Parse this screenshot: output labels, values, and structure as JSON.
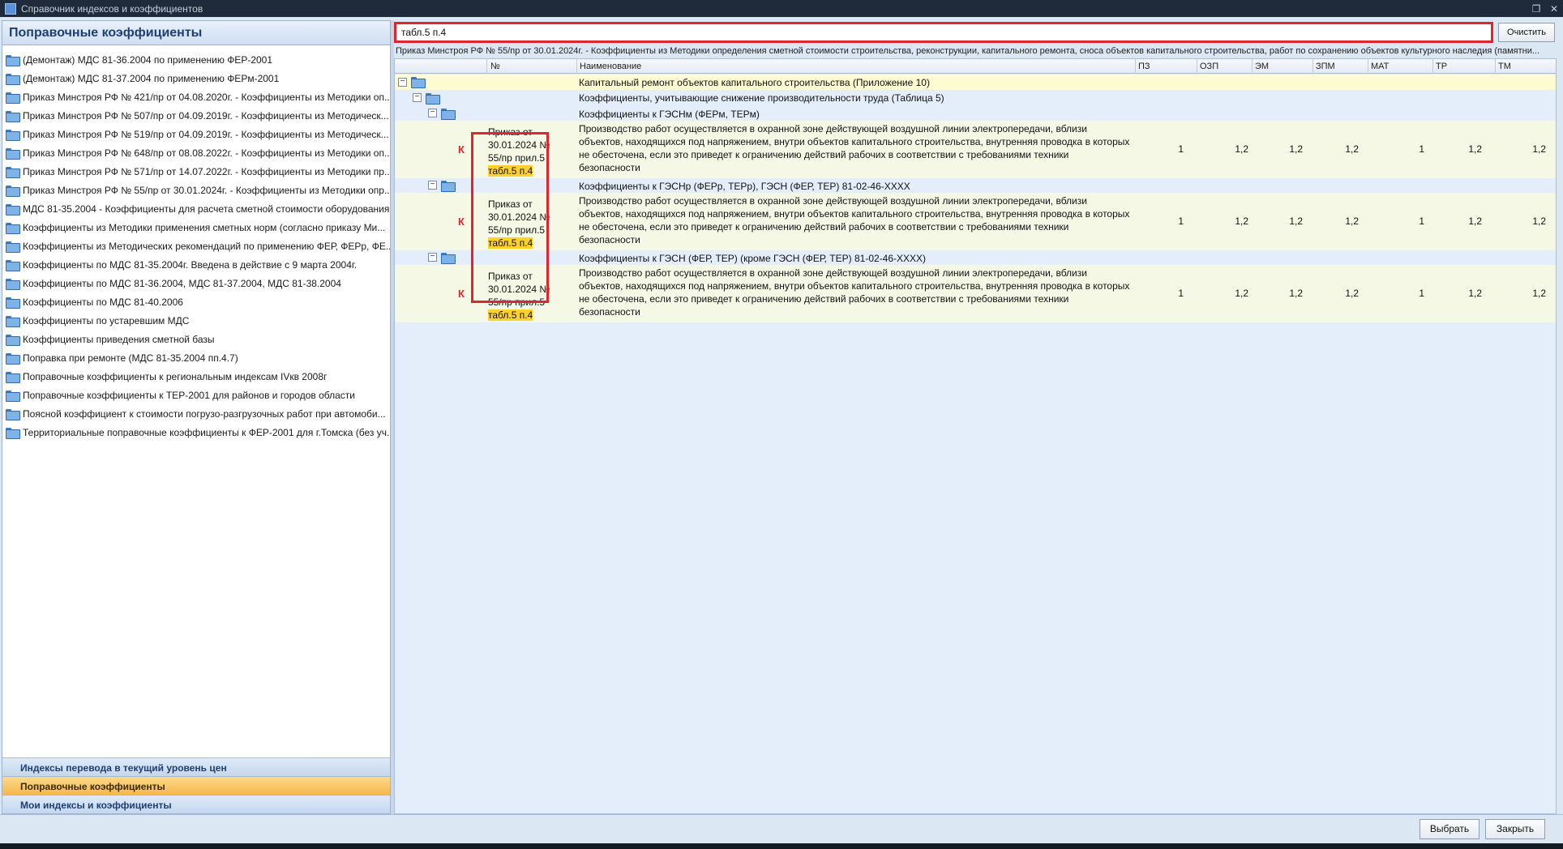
{
  "window": {
    "title": "Справочник индексов и коэффициентов"
  },
  "left": {
    "header": "Поправочные коэффициенты",
    "items": [
      "(Демонтаж)  МДС 81-36.2004 по применению ФЕР-2001",
      "(Демонтаж)  МДС 81-37.2004 по применению ФЕРм-2001",
      "Приказ Минстроя РФ № 421/пр от 04.08.2020г. - Коэффициенты из Методики оп...",
      "Приказ Минстроя РФ № 507/пр от 04.09.2019г. - Коэффициенты из Методическ...",
      "Приказ Минстроя РФ № 519/пр от 04.09.2019г. - Коэффициенты из Методическ...",
      "Приказ Минстроя РФ № 648/пр от 08.08.2022г. - Коэффициенты из Методики оп...",
      "Приказ Минстроя РФ № 571/пр от 14.07.2022г. - Коэффициенты из Методики пр...",
      "Приказ Минстроя РФ № 55/пр от 30.01.2024г. - Коэффициенты из Методики опр...",
      "МДС 81-35.2004 - Коэффициенты для расчета сметной стоимости оборудования",
      "Коэффициенты из Методики применения сметных норм (согласно приказу Ми...",
      "Коэффициенты из Методических рекомендаций по применению ФЕР, ФЕРр, ФЕ...",
      "Коэффициенты по МДС 81-35.2004г.  Введена в действие с 9 марта 2004г.",
      "Коэффициенты по МДС 81-36.2004, МДС 81-37.2004, МДС 81-38.2004",
      "Коэффициенты по МДС 81-40.2006",
      "Коэффициенты по устаревшим МДС",
      "Коэффициенты приведения сметной базы",
      "Поправка при ремонте (МДС 81-35.2004 пп.4.7)",
      "Поправочные коэффициенты к региональным индексам  IVкв 2008г",
      "Поправочные коэффициенты к ТЕР-2001 для районов и городов области",
      "Поясной коэффициент к стоимости погрузо-разгрузочных работ при автомоби...",
      "Территориальные поправочные коэффициенты к ФЕР-2001 для г.Томска (без уч..."
    ],
    "nav": [
      "Индексы перевода в текущий уровень цен",
      "Поправочные коэффициенты",
      "Мои индексы и коэффициенты"
    ]
  },
  "search": {
    "value": "табл.5 п.4",
    "clear_label": "Очистить"
  },
  "breadcrumb": "Приказ Минстроя РФ № 55/пр от 30.01.2024г. - Коэффициенты из Методики определения сметной стоимости строительства, реконструкции, капитального ремонта, сноса объектов капитального строительства, работ по сохранению объектов культурного наследия (памятни...",
  "grid": {
    "columns": [
      "№",
      "Наименование",
      "ПЗ",
      "ОЗП",
      "ЭМ",
      "ЗПМ",
      "МАТ",
      "ТР",
      "ТМ"
    ],
    "section": "Капитальный ремонт объектов капитального строительства (Приложение 10)",
    "subsection": "Коэффициенты, учитывающие снижение производительности труда (Таблица 5)",
    "groups": [
      {
        "title": "Коэффициенты к ГЭСНм (ФЕРм, ТЕРм)",
        "row": {
          "marker": "К",
          "num_prefix": "Приказ от 30.01.2024 № 55/пр прил.5",
          "num_highlight": "табл.5 п.4",
          "name": "Производство работ осуществляется в охранной зоне действующей воздушной линии электропередачи, вблизи объектов, находящихся под напряжением, внутри объектов капитального строительства, внутренняя проводка в которых не обесточена, если это приведет к ограничению действий рабочих в соответствии с требованиями техники безопасности",
          "pz": "1",
          "ozp": "1,2",
          "em": "1,2",
          "zpm": "1,2",
          "mat": "1",
          "tr": "1,2",
          "tm": "1,2"
        }
      },
      {
        "title": "Коэффициенты к ГЭСНр (ФЕРр, ТЕРр), ГЭСН (ФЕР, ТЕР) 81-02-46-XXXX",
        "row": {
          "marker": "К",
          "num_prefix": "Приказ от 30.01.2024 № 55/пр прил.5",
          "num_highlight": "табл.5 п.4",
          "name": "Производство работ осуществляется в охранной зоне действующей воздушной линии электропередачи, вблизи объектов, находящихся под напряжением, внутри объектов капитального строительства, внутренняя проводка в которых не обесточена, если это приведет к ограничению действий рабочих в соответствии с требованиями техники безопасности",
          "pz": "1",
          "ozp": "1,2",
          "em": "1,2",
          "zpm": "1,2",
          "mat": "1",
          "tr": "1,2",
          "tm": "1,2"
        }
      },
      {
        "title": "Коэффициенты к ГЭСН (ФЕР, ТЕР) (кроме ГЭСН (ФЕР, ТЕР) 81-02-46-XXXX)",
        "row": {
          "marker": "К",
          "num_prefix": "Приказ от 30.01.2024 № 55/пр прил.5",
          "num_highlight": "табл.5 п.4",
          "name": "Производство работ осуществляется в охранной зоне действующей воздушной линии электропередачи, вблизи объектов, находящихся под напряжением, внутри объектов капитального строительства, внутренняя проводка в которых не обесточена, если это приведет к ограничению действий рабочих в соответствии с требованиями техники безопасности",
          "pz": "1",
          "ozp": "1,2",
          "em": "1,2",
          "zpm": "1,2",
          "mat": "1",
          "tr": "1,2",
          "tm": "1,2"
        }
      }
    ]
  },
  "buttons": {
    "select": "Выбрать",
    "close": "Закрыть"
  }
}
